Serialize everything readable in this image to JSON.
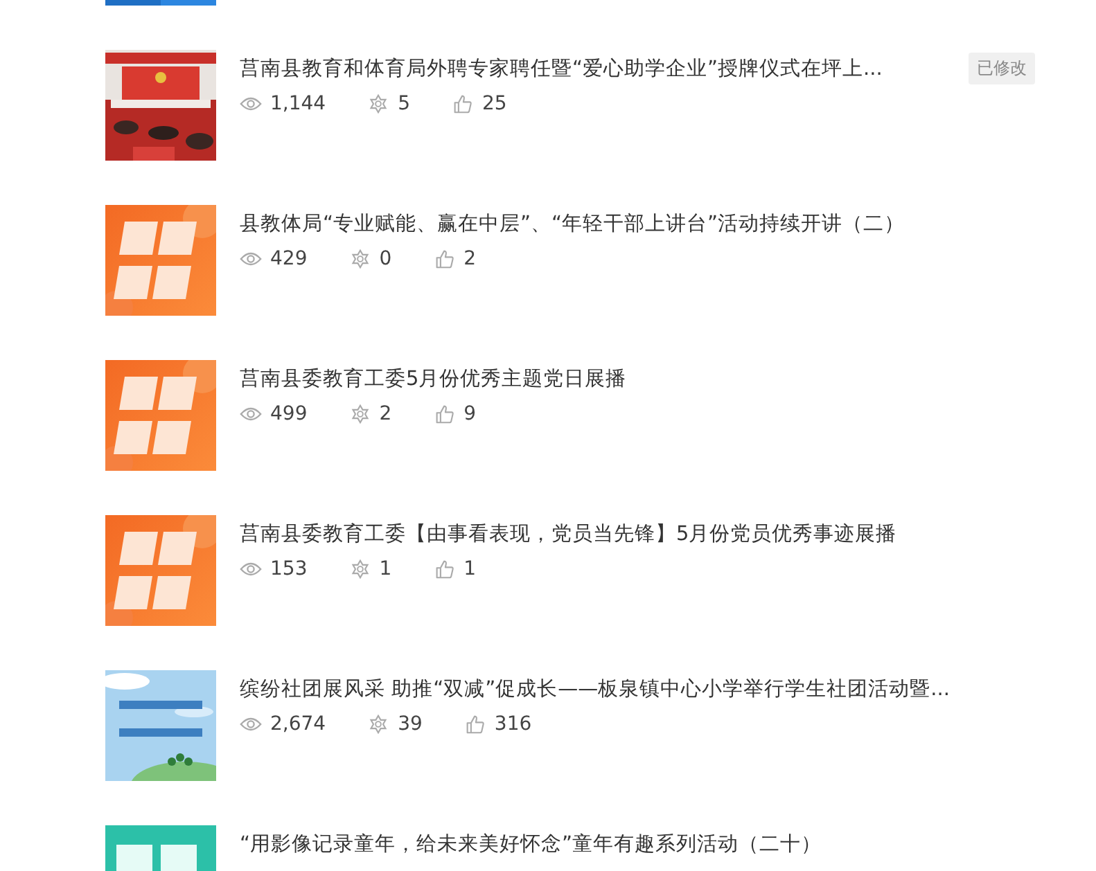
{
  "articles": [
    {
      "title": "莒南县教育和体育局外聘专家聘任暨“爱心助学企业”授牌仪式在坪上...",
      "badge": "已修改",
      "views": "1,144",
      "stat_2": "5",
      "likes": "25"
    },
    {
      "kind": "orange",
      "title": "县教体局“专业赋能、赢在中层”、“年轻干部上讲台”活动持续开讲（二）",
      "views": "429",
      "stat_2": "0",
      "likes": "2"
    },
    {
      "kind": "orange",
      "title": "莒南县委教育工委5月份优秀主题党日展播",
      "views": "499",
      "stat_2": "2",
      "likes": "9"
    },
    {
      "kind": "orange",
      "title": "莒南县委教育工委【由事看表现，党员当先锋】5月份党员优秀事迹展播",
      "views": "153",
      "stat_2": "1",
      "likes": "1"
    },
    {
      "kind": "sky",
      "title": "缤纷社团展风采  助推“双减”促成长——板泉镇中心小学举行学生社团活动暨...",
      "views": "2,674",
      "stat_2": "39",
      "likes": "316"
    },
    {
      "kind": "teal",
      "title": "“用影像记录童年，给未来美好怀念”童年有趣系列活动（二十）"
    }
  ]
}
